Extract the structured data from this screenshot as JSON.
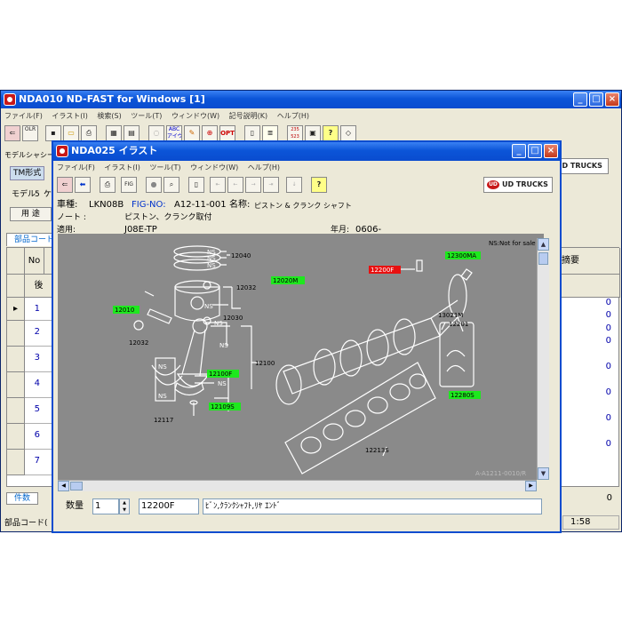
{
  "main": {
    "title": "NDA010 ND-FAST for Windows [1]",
    "menu": [
      "ファイル(F)",
      "イラスト(I)",
      "検索(S)",
      "ツール(T)",
      "ウィンドウ(W)",
      "記号説明(K)",
      "ヘルプ(H)"
    ],
    "toolbar_labels": {
      "olr": "OLR",
      "abc": "ABC\nアイウ",
      "opt": "OPT",
      "num": "235\n523"
    },
    "brand": "UD TRUCKS",
    "left_labels": {
      "model_chassis": "モデルシャシー",
      "tm_type": "TM形式",
      "model": "モデル",
      "model_num": "5",
      "model_suffix": "ケ",
      "usage": "用 途"
    },
    "tab_parts": "部品コード",
    "col_no": "No",
    "col_back": "後",
    "col_desc": "摘要",
    "rows": [
      "1",
      "2",
      "3",
      "4",
      "5",
      "6",
      "7"
    ],
    "zeros": [
      "0",
      "0",
      "0",
      "0",
      "0",
      "0",
      "0",
      "0"
    ],
    "count_label": "件数",
    "count_value": "0",
    "status_left": "部品コード(",
    "status_time": "1:58"
  },
  "sub": {
    "title": "NDA025 イラスト",
    "menu": [
      "ファイル(F)",
      "イラスト(I)",
      "ツール(T)",
      "ウィンドウ(W)",
      "ヘルプ(H)"
    ],
    "brand": "UD TRUCKS",
    "info": {
      "vehicle_label": "車種:",
      "vehicle": "LKN08B",
      "fig_label": "FIG-NO:",
      "fig": "A12-11-001",
      "name_label": "名称:",
      "name": "ピストン & クランク シャフト",
      "note_label": "ノート :",
      "note": "ピストン、クランク取付",
      "apply_label": "適用:",
      "apply": "J08E-TP",
      "year_label": "年月:",
      "year": "0606-"
    },
    "drawing": {
      "ns_note": "NS:Not for sale",
      "fig_ref": "A-A1211-0010/R",
      "labels": {
        "p12040": "12040",
        "p12032a": "12032",
        "p12010": "12010",
        "p12020m": "12020M",
        "p12032b": "12032",
        "p12030": "12030",
        "p12100": "12100",
        "p12100f": "12100F",
        "p12109s": "12109S",
        "p12117": "12117",
        "p12200f": "12200F",
        "p12300ma": "12300MA",
        "p13021m": "13021M",
        "p12201": "12201",
        "p12280s": "12280S",
        "p12213s": "12213S",
        "ns": "NS"
      }
    },
    "footer": {
      "qty_label": "数量",
      "qty": "1",
      "part_code": "12200F",
      "part_name": "ﾋﾞﾝ,ｸﾗﾝｸｼｬﾌﾄ,ﾘﾔ ｴﾝﾄﾞ"
    }
  }
}
